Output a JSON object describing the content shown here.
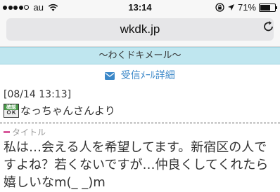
{
  "status_bar": {
    "carrier": "au",
    "time": "13:14",
    "battery": "71%",
    "signal_bars": 4,
    "battery_level": 0.71
  },
  "browser": {
    "url": "wkdk.jp"
  },
  "page": {
    "header": "〜わくドキメール〜",
    "detail_link": "受信ﾒｰﾙ詳細",
    "date": "[08/14 13:13]",
    "badge_top": "確認",
    "badge_bottom": "ＯＫ",
    "sender": "なっちゃんさんより",
    "title_label": "タイトル",
    "message": "私は…会える人を希望してます。新宿区の人ですよね？若くないですが…仲良くしてくれたら嬉しいなm(_ _)m"
  },
  "colors": {
    "band": "#bfe6ef",
    "link": "#3a87c8",
    "title_mark": "#d85a9c"
  }
}
